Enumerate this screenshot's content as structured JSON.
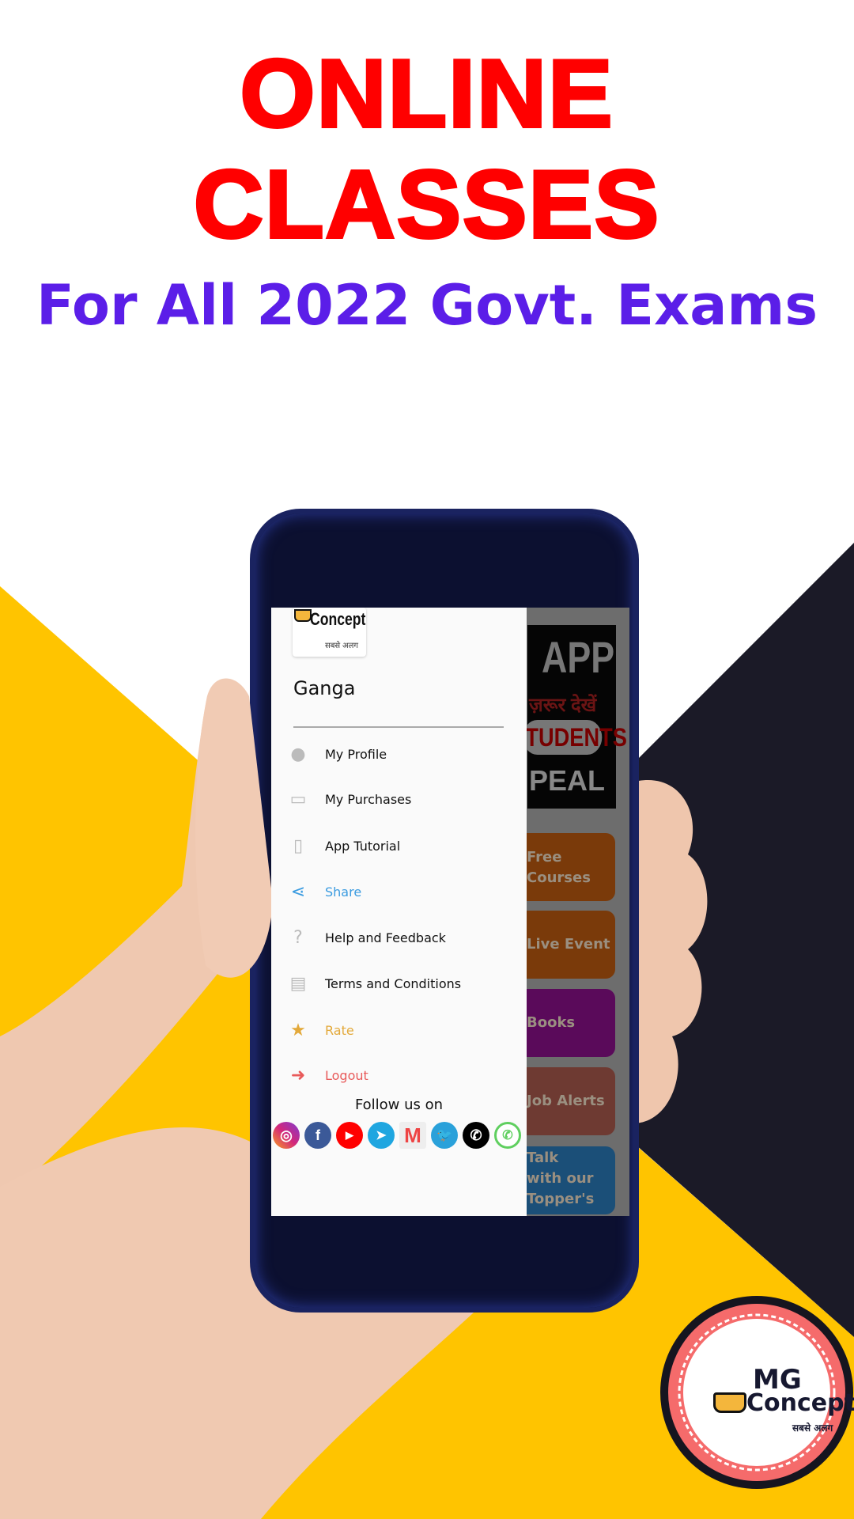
{
  "headline": "ONLINE CLASSES",
  "subheadline": "For All 2022 Govt. Exams",
  "colors": {
    "headline": "#ff0000",
    "subheadline": "#5b1ee8",
    "yellow": "#ffc400",
    "dark": "#1b1a27",
    "badge_ring": "#f56b6b"
  },
  "drawer": {
    "logo_text": "Concept",
    "logo_tagline": "सबसे अलग",
    "user_name": "Ganga",
    "items": [
      {
        "label": "My Profile",
        "icon": "profile-icon",
        "color": "#111111"
      },
      {
        "label": "My Purchases",
        "icon": "purchases-icon",
        "color": "#111111"
      },
      {
        "label": "App Tutorial",
        "icon": "tutorial-icon",
        "color": "#111111"
      },
      {
        "label": "Share",
        "icon": "share-icon",
        "color": "#3a9be0"
      },
      {
        "label": "Help and Feedback",
        "icon": "help-icon",
        "color": "#111111"
      },
      {
        "label": "Terms and Conditions",
        "icon": "terms-icon",
        "color": "#111111"
      },
      {
        "label": "Rate",
        "icon": "star-icon",
        "color": "#e3a93a"
      },
      {
        "label": "Logout",
        "icon": "logout-icon",
        "color": "#e85a5a"
      }
    ],
    "follow_label": "Follow us on",
    "social": [
      "instagram",
      "facebook",
      "youtube",
      "telegram",
      "gmail",
      "twitter",
      "phone",
      "whatsapp"
    ]
  },
  "background_app": {
    "banner": {
      "line1": "APP",
      "line2": "ज़रूर देखें",
      "line3": "TUDENTS",
      "line4": "PEAL"
    },
    "tiles": [
      "Free\nCourses",
      "Live Event",
      "Books",
      "Job Alerts",
      "Talk\nwith our\nTopper's"
    ]
  },
  "badge": {
    "brand_line1": "MG",
    "brand_line2": "Concept",
    "tagline": "सबसे अलग"
  }
}
